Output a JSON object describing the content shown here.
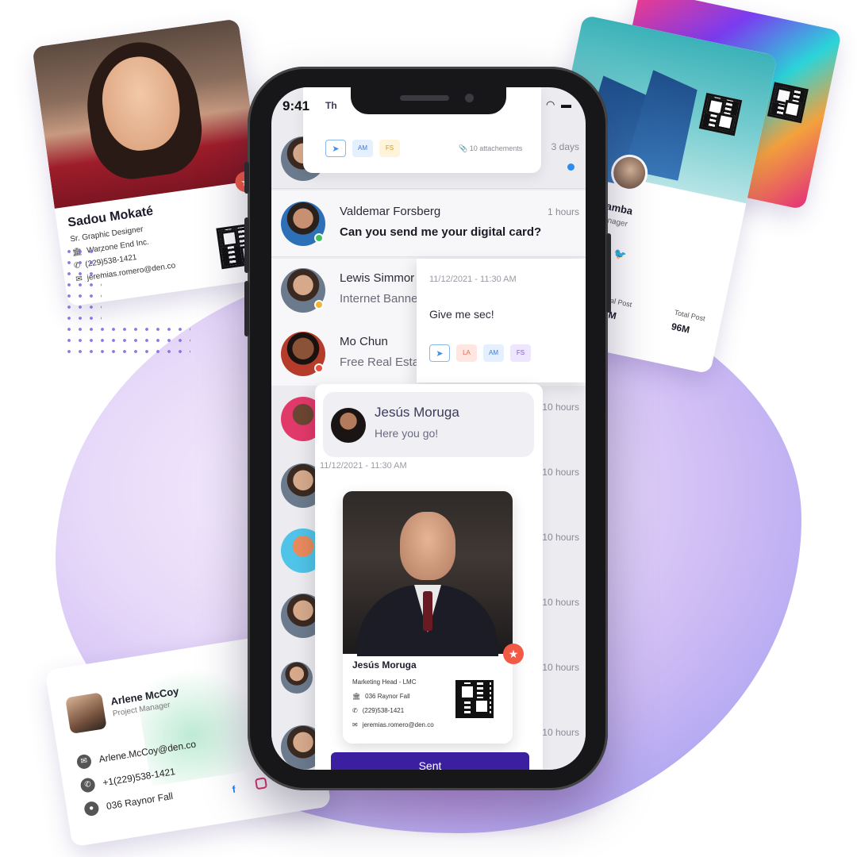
{
  "cards": {
    "sadou": {
      "name": "Sadou Mokaté",
      "title": "Sr. Graphic Designer",
      "company": "Warzone End Inc.",
      "phone": "(229)538-1421",
      "email": "jeremias.romero@den.co"
    },
    "right": {
      "name_partial": "amba",
      "title_partial": "anager",
      "stat1_label": "Total Post",
      "stat1_value": "96M",
      "stat2_label": "Total Post",
      "stat2_value": "96M"
    },
    "arlene": {
      "name": "Arlene McCoy",
      "title": "Project Manager",
      "email": "Arlene.McCoy@den.co",
      "phone": "+1(229)538-1421",
      "address": "036 Raynor Fall"
    }
  },
  "status_bar": {
    "time": "9:41"
  },
  "top_popup": {
    "title_partial": "Th",
    "chips": [
      "AM",
      "FS"
    ],
    "attachments": "10 attachements",
    "time": "3 days"
  },
  "conversations": [
    {
      "name": "Valdemar Forsberg",
      "message": "Can you send me your digital card?",
      "time": "1 hours"
    },
    {
      "name": "Lewis Simmor",
      "message": "Internet Banne",
      "time": ""
    },
    {
      "name": "Mo Chun",
      "message": "Free Real Estat",
      "time": ""
    }
  ],
  "faded_times": [
    "10 hours",
    "10 hours",
    "10 hours",
    "10 hours",
    "10 hours",
    "10 hours"
  ],
  "message_popup": {
    "timestamp": "11/12/2021 - 11:30 AM",
    "text": "Give me sec!",
    "chips": [
      "LA",
      "AM",
      "FS"
    ]
  },
  "chat": {
    "contact_name": "Jesús Moruga",
    "reply": "Here you go!",
    "timestamp": "11/12/2021 - 11:30 AM",
    "card": {
      "name": "Jesús Moruga",
      "title": "Marketing Head - LMC",
      "address": "036 Raynor Fall",
      "phone": "(229)538-1421",
      "email": "jeremias.romero@den.co"
    },
    "send_label": "Sent"
  },
  "colors": {
    "accent": "#3b1fa0",
    "badge": "#f25a45",
    "unread": "#2d8cf0"
  }
}
